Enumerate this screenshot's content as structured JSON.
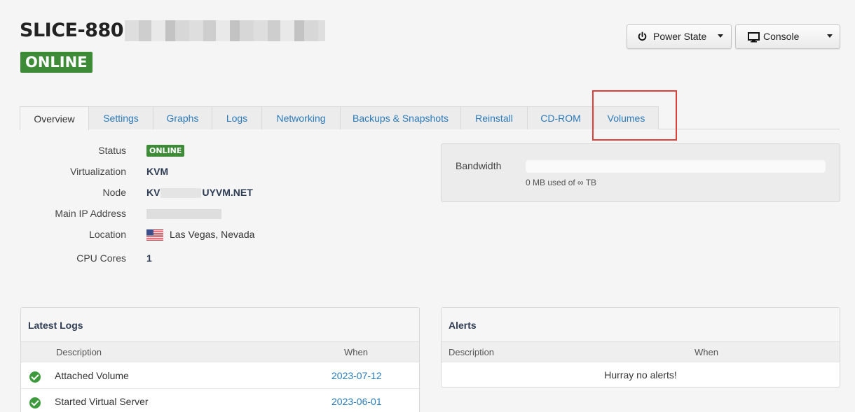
{
  "header": {
    "title": "SLICE-880",
    "status": "ONLINE"
  },
  "actions": {
    "power_state": "Power State",
    "console": "Console"
  },
  "tabs": [
    "Overview",
    "Settings",
    "Graphs",
    "Logs",
    "Networking",
    "Backups & Snapshots",
    "Reinstall",
    "CD-ROM",
    "Volumes"
  ],
  "active_tab": "Overview",
  "overview": {
    "status_label": "Status",
    "status_value": "ONLINE",
    "virt_label": "Virtualization",
    "virt_value": "KVM",
    "node_label": "Node",
    "node_prefix": "KV",
    "node_suffix": "UYVM.NET",
    "ip_label": "Main IP Address",
    "location_label": "Location",
    "location_value": "Las Vegas, Nevada",
    "cpu_label": "CPU Cores",
    "cpu_value": "1"
  },
  "bandwidth": {
    "label": "Bandwidth",
    "usage_text": "0 MB used of ∞ TB",
    "used_fraction": 0
  },
  "latest_logs": {
    "title": "Latest Logs",
    "col_description": "Description",
    "col_when": "When",
    "rows": [
      {
        "description": "Attached Volume",
        "when": "2023-07-12"
      },
      {
        "description": "Started Virtual Server",
        "when": "2023-06-01"
      }
    ]
  },
  "alerts": {
    "title": "Alerts",
    "col_description": "Description",
    "col_when": "When",
    "empty_text": "Hurray no alerts!"
  },
  "colors": {
    "online_green": "#3d8b37",
    "link_blue": "#2a7ab8",
    "highlight_red": "#e0403a"
  }
}
